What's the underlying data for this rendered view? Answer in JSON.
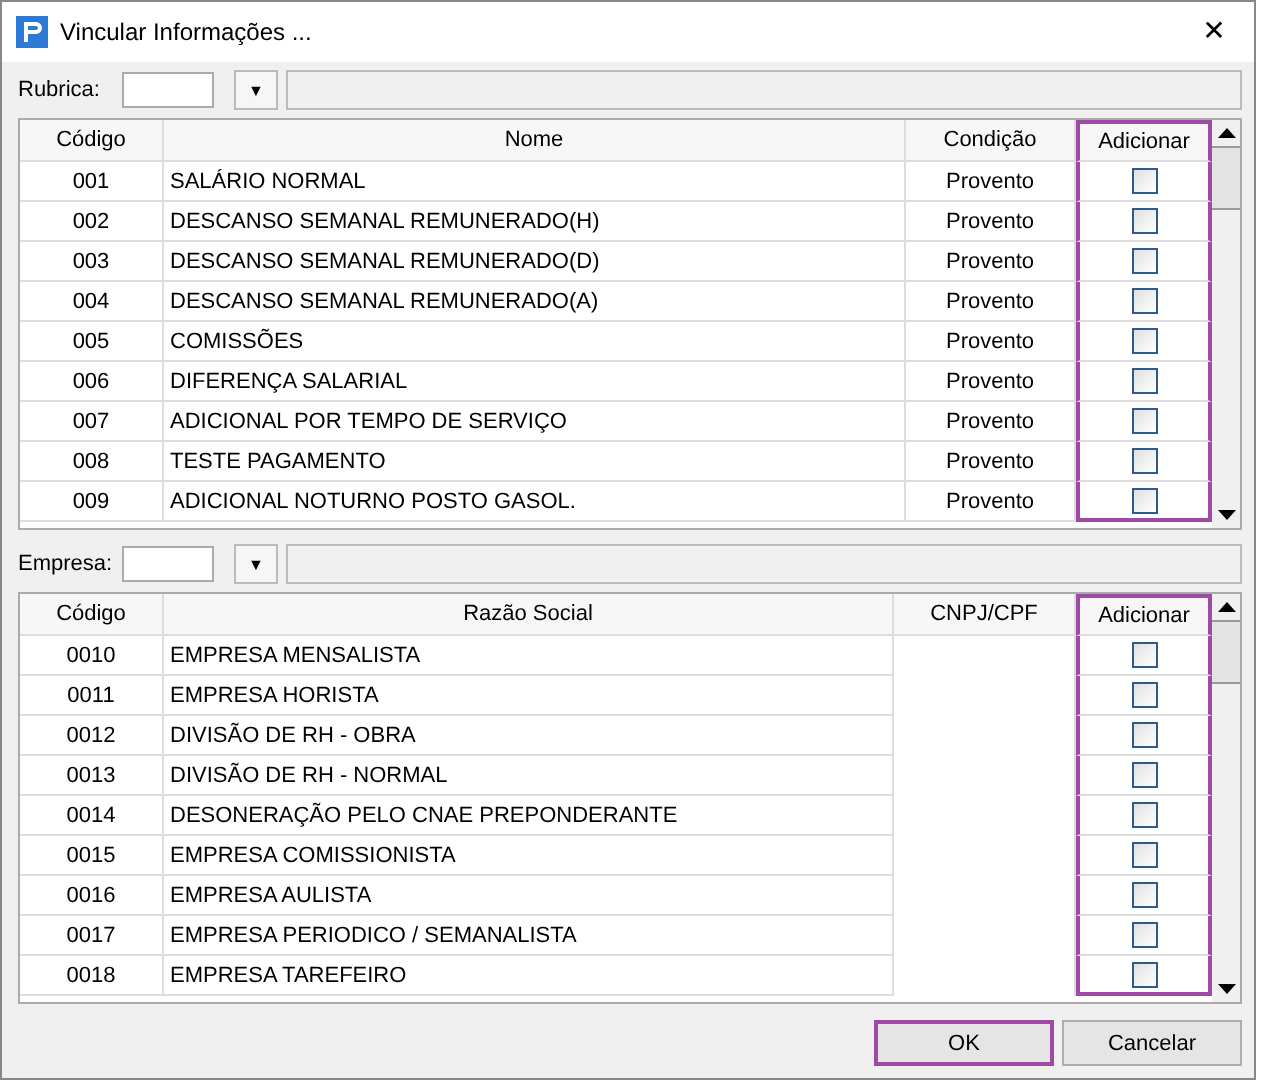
{
  "window": {
    "title": "Vincular Informações  ...",
    "close": "✕"
  },
  "rubrica": {
    "label": "Rubrica:",
    "dropdown": "▼",
    "table": {
      "columns": [
        {
          "label": "Código",
          "highlighted": false
        },
        {
          "label": "Nome",
          "highlighted": false
        },
        {
          "label": "Condição",
          "highlighted": false
        },
        {
          "label": "Adicionar",
          "highlighted": true
        }
      ],
      "rows": [
        {
          "code": "001",
          "name": "SALÁRIO NORMAL",
          "condition": "Provento",
          "checked": false
        },
        {
          "code": "002",
          "name": "DESCANSO SEMANAL REMUNERADO(H)",
          "condition": "Provento",
          "checked": false
        },
        {
          "code": "003",
          "name": "DESCANSO SEMANAL REMUNERADO(D)",
          "condition": "Provento",
          "checked": false
        },
        {
          "code": "004",
          "name": "DESCANSO SEMANAL REMUNERADO(A)",
          "condition": "Provento",
          "checked": false
        },
        {
          "code": "005",
          "name": "COMISSÕES",
          "condition": "Provento",
          "checked": false
        },
        {
          "code": "006",
          "name": "DIFERENÇA SALARIAL",
          "condition": "Provento",
          "checked": false
        },
        {
          "code": "007",
          "name": "ADICIONAL POR TEMPO DE SERVIÇO",
          "condition": "Provento",
          "checked": false
        },
        {
          "code": "008",
          "name": "TESTE PAGAMENTO",
          "condition": "Provento",
          "checked": false
        },
        {
          "code": "009",
          "name": "ADICIONAL NOTURNO POSTO GASOL.",
          "condition": "Provento",
          "checked": false
        }
      ]
    }
  },
  "empresa": {
    "label": "Empresa:",
    "dropdown": "▼",
    "table": {
      "columns": [
        {
          "label": "Código",
          "highlighted": false
        },
        {
          "label": "Razão Social",
          "highlighted": false
        },
        {
          "label": "CNPJ/CPF",
          "highlighted": false
        },
        {
          "label": "Adicionar",
          "highlighted": true
        }
      ],
      "rows": [
        {
          "code": "0010",
          "name": "EMPRESA MENSALISTA",
          "checked": false
        },
        {
          "code": "0011",
          "name": "EMPRESA HORISTA",
          "checked": false
        },
        {
          "code": "0012",
          "name": "DIVISÃO DE RH - OBRA",
          "checked": false
        },
        {
          "code": "0013",
          "name": "DIVISÃO DE RH - NORMAL",
          "checked": false
        },
        {
          "code": "0014",
          "name": "DESONERAÇÃO PELO CNAE PREPONDERANTE",
          "checked": false
        },
        {
          "code": "0015",
          "name": "EMPRESA COMISSIONISTA",
          "checked": false
        },
        {
          "code": "0016",
          "name": "EMPRESA AULISTA",
          "checked": false
        },
        {
          "code": "0017",
          "name": "EMPRESA PERIODICO / SEMANALISTA",
          "checked": false
        },
        {
          "code": "0018",
          "name": "EMPRESA TAREFEIRO",
          "checked": false
        }
      ]
    }
  },
  "buttons": [
    {
      "label": "OK",
      "highlighted": true
    },
    {
      "label": "Cancelar",
      "highlighted": false
    }
  ]
}
